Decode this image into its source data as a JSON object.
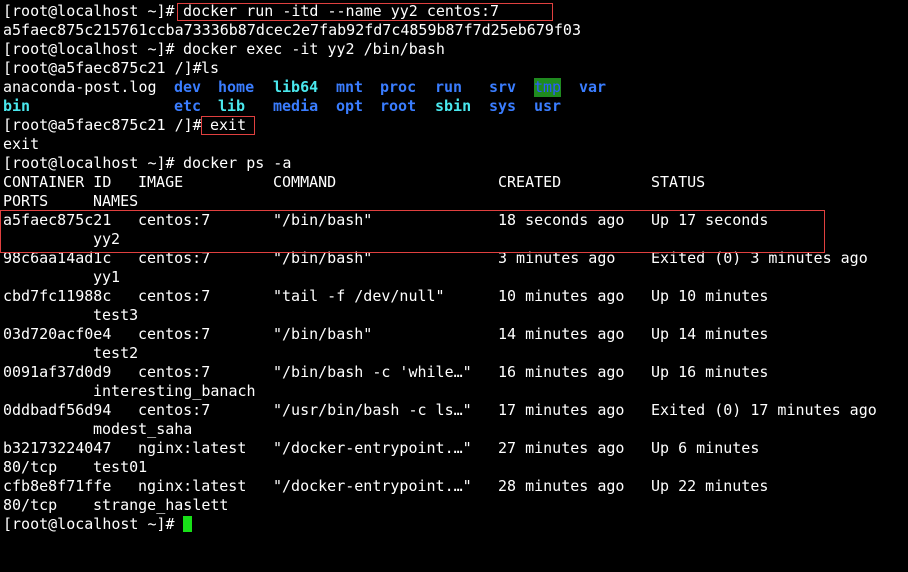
{
  "terminal": {
    "prompt_host": "[root@localhost ~]# ",
    "prompt_container": "[root@a5faec875c21 /]# ",
    "cmd_run": "docker run -itd --name yy2 centos:7",
    "container_id_full": "a5faec875c215761ccba73336b87dcec2e7fab92fd7c4859b87f7d25eb679f03",
    "cmd_exec": "docker exec -it yy2 /bin/bash",
    "cmd_ls": "ls",
    "ls_row1": [
      "anaconda-post.log",
      "dev",
      "home",
      "lib64",
      "mnt",
      "proc",
      "run",
      "srv",
      "tmp",
      "var"
    ],
    "ls_row2": [
      "bin",
      "etc",
      "lib",
      "media",
      "opt",
      "root",
      "sbin",
      "sys",
      "usr"
    ],
    "cmd_exit": "exit",
    "exit_output": "exit",
    "cmd_ps": "docker ps -a",
    "headers": {
      "container_id": "CONTAINER ID",
      "image": "IMAGE",
      "command": "COMMAND",
      "created": "CREATED",
      "status": "STATUS",
      "ports": "PORTS",
      "names": "NAMES"
    },
    "rows": [
      {
        "id": "a5faec875c21",
        "image": "centos:7",
        "command": "\"/bin/bash\"",
        "created": "18 seconds ago",
        "status": "Up 17 seconds",
        "ports": "",
        "name": "yy2"
      },
      {
        "id": "98c6aa14ad1c",
        "image": "centos:7",
        "command": "\"/bin/bash\"",
        "created": "3 minutes ago",
        "status": "Exited (0) 3 minutes ago",
        "ports": "",
        "name": "yy1"
      },
      {
        "id": "cbd7fc11988c",
        "image": "centos:7",
        "command": "\"tail -f /dev/null\"",
        "created": "10 minutes ago",
        "status": "Up 10 minutes",
        "ports": "",
        "name": "test3"
      },
      {
        "id": "03d720acf0e4",
        "image": "centos:7",
        "command": "\"/bin/bash\"",
        "created": "14 minutes ago",
        "status": "Up 14 minutes",
        "ports": "",
        "name": "test2"
      },
      {
        "id": "0091af37d0d9",
        "image": "centos:7",
        "command": "\"/bin/bash -c 'while…\"",
        "created": "16 minutes ago",
        "status": "Up 16 minutes",
        "ports": "",
        "name": "interesting_banach"
      },
      {
        "id": "0ddbadf56d94",
        "image": "centos:7",
        "command": "\"/usr/bin/bash -c ls…\"",
        "created": "17 minutes ago",
        "status": "Exited (0) 17 minutes ago",
        "ports": "",
        "name": "modest_saha"
      },
      {
        "id": "b32173224047",
        "image": "nginx:latest",
        "command": "\"/docker-entrypoint.…\"",
        "created": "27 minutes ago",
        "status": "Up 6 minutes",
        "ports": "80/tcp",
        "name": "test01"
      },
      {
        "id": "cfb8e8f71ffe",
        "image": "nginx:latest",
        "command": "\"/docker-entrypoint.…\"",
        "created": "28 minutes ago",
        "status": "Up 22 minutes",
        "ports": "80/tcp",
        "name": "strange_haslett"
      }
    ]
  },
  "colors": {
    "background": "#000000",
    "text": "#ffffff",
    "directory": "#3a7dff",
    "link": "#4ae8ee",
    "highlight_box": "#e0403f",
    "cursor": "#18e018"
  }
}
